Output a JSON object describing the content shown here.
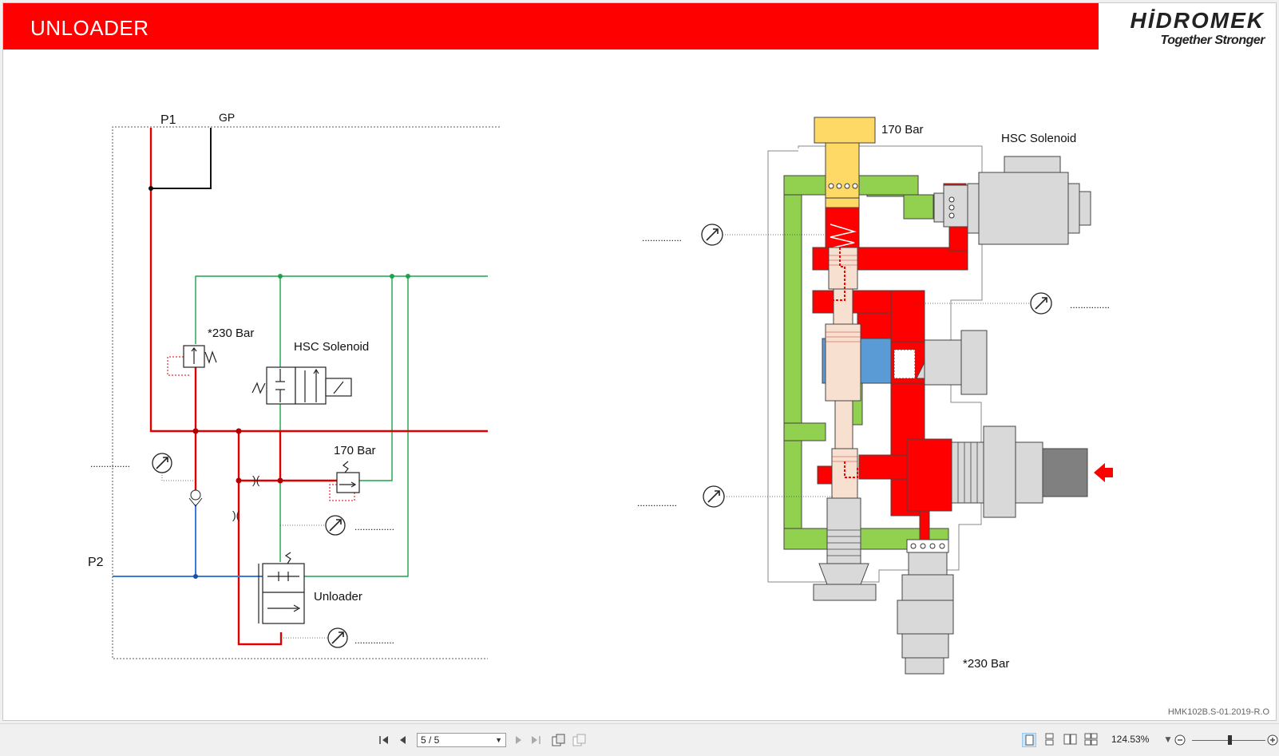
{
  "slide": {
    "title": "UNLOADER",
    "logo_brand": "HİDROMEK",
    "logo_tagline": "Together Stronger",
    "doc_ref": "HMK102B.S-01.2019-R.O",
    "colors": {
      "title_bar": "#ff0000",
      "pressure_line": "#e00000",
      "return_line": "#22aa44",
      "pump2_line": "#3a7bd5",
      "tank_block": "#92d050",
      "valve_body": "#ffd966",
      "spool": "#f8e0d0",
      "blue_chamber": "#5b9bd5"
    }
  },
  "schematic": {
    "label_p1": "P1",
    "label_gp": "GP",
    "label_p2": "P2",
    "label_relief": "*230 Bar",
    "label_hsc": "HSC Solenoid",
    "label_170": "170 Bar",
    "label_unloader": "Unloader",
    "gauge_dots_1": "...............",
    "gauge_dots_2": "...............",
    "gauge_dots_3": "..............."
  },
  "section": {
    "label_170": "170 Bar",
    "label_hsc": "HSC Solenoid",
    "label_230": "*230 Bar",
    "gauge_dots_left_top": "...............",
    "gauge_dots_right": "...............",
    "gauge_dots_left_bottom": "..............."
  },
  "toolbar": {
    "page_indicator": "5 / 5",
    "zoom": "124.53%",
    "zoom_slider_level": 0.5,
    "icons": [
      "first-page-icon",
      "prev-page-icon",
      "next-page-icon",
      "last-page-icon",
      "extract-page-icon",
      "insert-page-icon",
      "single-page-view-icon",
      "continuous-view-icon",
      "two-page-view-icon",
      "two-page-continuous-view-icon",
      "zoom-out-icon",
      "zoom-in-icon"
    ]
  }
}
